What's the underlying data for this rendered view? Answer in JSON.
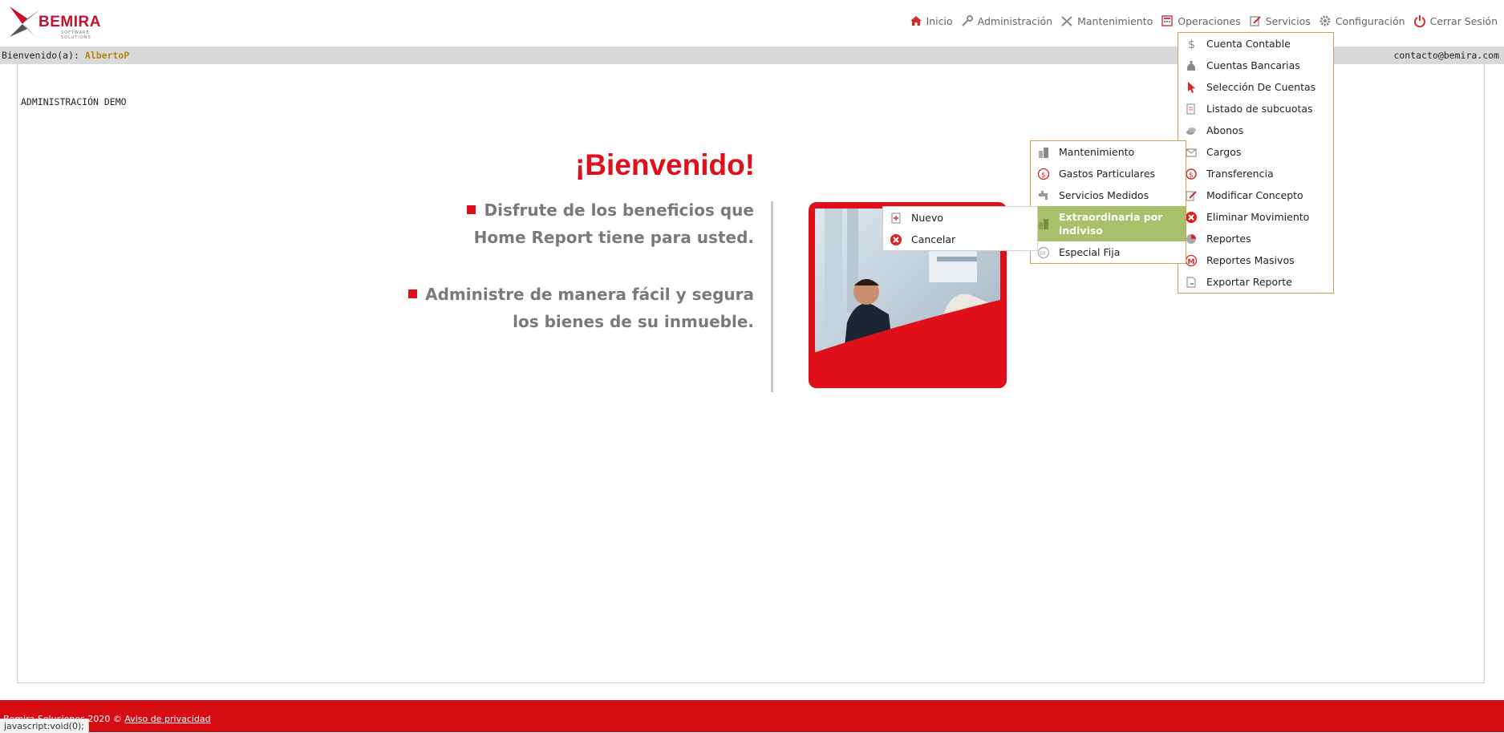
{
  "brand": {
    "name": "BEMIRA",
    "tagline": "SOFTWARE SOLUTIONS"
  },
  "nav": {
    "items": [
      {
        "label": "Inicio",
        "icon": "home-icon"
      },
      {
        "label": "Administración",
        "icon": "key-icon"
      },
      {
        "label": "Mantenimiento",
        "icon": "tools-icon"
      },
      {
        "label": "Operaciones",
        "icon": "calculator-icon"
      },
      {
        "label": "Servicios",
        "icon": "edit-icon"
      },
      {
        "label": "Configuración",
        "icon": "gear-icon"
      },
      {
        "label": "Cerrar Sesión",
        "icon": "power-icon"
      }
    ]
  },
  "welcome_bar": {
    "prefix": "Bienvenido(a):",
    "user": "AlbertoP",
    "email": "contacto@bemira.com"
  },
  "admin_label": "ADMINISTRACIÓN DEMO",
  "hero": {
    "title": "¡Bienvenido!",
    "bullet1_line1": "Disfrute de los beneficios que",
    "bullet1_line2": "Home Report tiene para usted.",
    "bullet2_line1": "Administre de manera fácil y segura",
    "bullet2_line2": "los bienes de su inmueble."
  },
  "operaciones_menu": {
    "items": [
      {
        "label": "Cuenta Contable",
        "icon": "dollar-icon"
      },
      {
        "label": "Cuentas Bancarias",
        "icon": "money-bag-icon"
      },
      {
        "label": "Selección De Cuentas",
        "icon": "cursor-icon"
      },
      {
        "label": "Listado de subcuotas",
        "icon": "list-icon"
      },
      {
        "label": "Abonos",
        "icon": "coins-icon"
      },
      {
        "label": "Cargos",
        "icon": "charge-icon"
      },
      {
        "label": "Transferencia",
        "icon": "transfer-icon"
      },
      {
        "label": "Modificar Concepto",
        "icon": "edit-icon"
      },
      {
        "label": "Eliminar Movimiento",
        "icon": "delete-icon"
      },
      {
        "label": "Reportes",
        "icon": "pie-chart-icon"
      },
      {
        "label": "Reportes Masivos",
        "icon": "letter-m-icon"
      },
      {
        "label": "Exportar Reporte",
        "icon": "export-icon"
      }
    ]
  },
  "cargos_submenu": {
    "items": [
      {
        "label": "Mantenimiento",
        "icon": "building-icon"
      },
      {
        "label": "Gastos Particulares",
        "icon": "dollar-circle-icon"
      },
      {
        "label": "Servicios Medidos",
        "icon": "faucet-icon"
      },
      {
        "label": "Extraordinaria por indiviso",
        "line1": "Extraordinaria por",
        "line2": "indiviso",
        "icon": "building-icon"
      },
      {
        "label": "Especial Fija",
        "icon": "ef-icon"
      }
    ]
  },
  "extraordinaria_submenu": {
    "items": [
      {
        "label": "Nuevo",
        "icon": "new-document-icon"
      },
      {
        "label": "Cancelar",
        "icon": "cancel-icon"
      }
    ]
  },
  "footer": {
    "copyright": "Bemira Soluciones 2020 © ",
    "privacy_link": "Aviso de privacidad"
  },
  "statusbar": {
    "text": "javascript:void(0);"
  }
}
